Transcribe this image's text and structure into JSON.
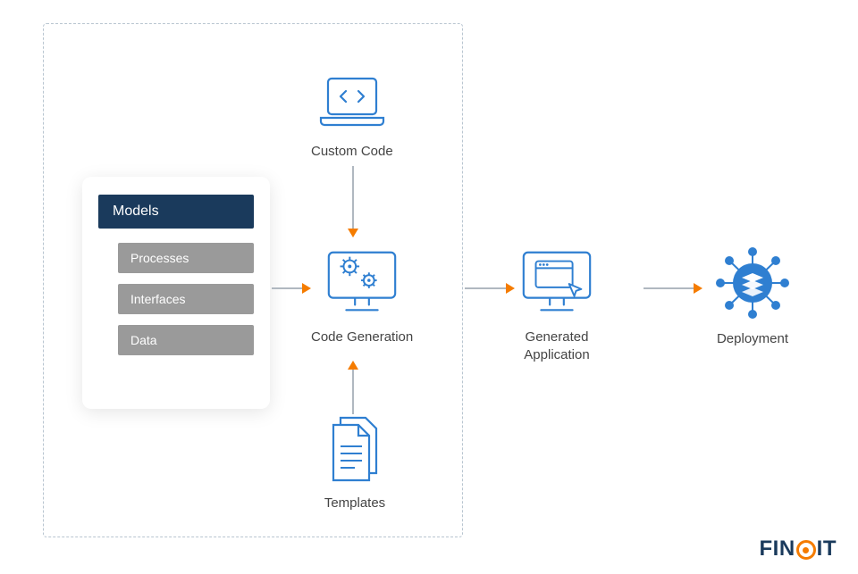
{
  "models": {
    "header": "Models",
    "items": [
      "Processes",
      "Interfaces",
      "Data"
    ]
  },
  "nodes": {
    "custom_code": "Custom Code",
    "code_generation": "Code Generation",
    "templates": "Templates",
    "generated_application": "Generated\nApplication",
    "deployment": "Deployment"
  },
  "logo": {
    "part1": "FIN",
    "part2": "IT"
  }
}
